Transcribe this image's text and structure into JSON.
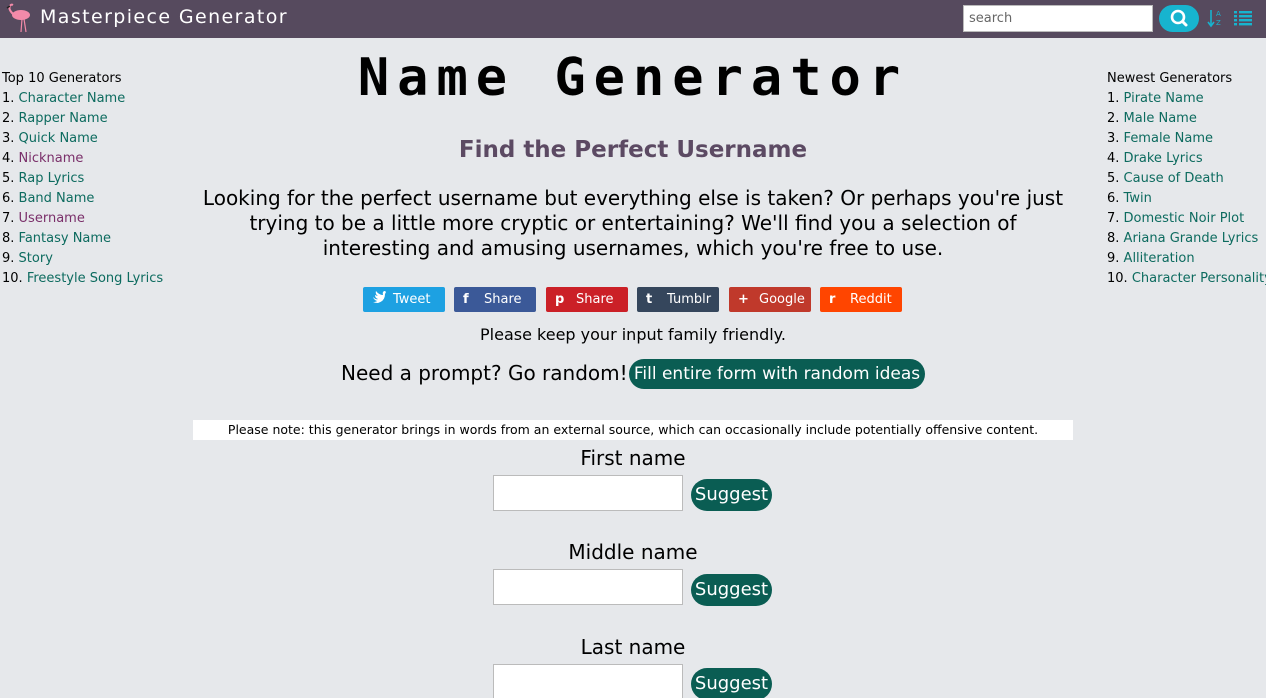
{
  "header": {
    "brand": "Masterpiece Generator",
    "search_placeholder": "search",
    "accent_color": "#17b4cf",
    "bar_color": "#564a5e",
    "icons": [
      "flamingo-logo-icon",
      "search-icon",
      "sort-alpha-icon",
      "list-icon"
    ]
  },
  "left_sidebar": {
    "heading": "Top 10 Generators",
    "items": [
      {
        "num": "1.",
        "label": "Character Name"
      },
      {
        "num": "2.",
        "label": "Rapper Name"
      },
      {
        "num": "3.",
        "label": "Quick Name"
      },
      {
        "num": "4.",
        "label": "Nickname"
      },
      {
        "num": "5.",
        "label": "Rap Lyrics"
      },
      {
        "num": "6.",
        "label": "Band Name"
      },
      {
        "num": "7.",
        "label": "Username"
      },
      {
        "num": "8.",
        "label": "Fantasy Name"
      },
      {
        "num": "9.",
        "label": "Story"
      },
      {
        "num": "10.",
        "label": "Freestyle Song Lyrics"
      }
    ]
  },
  "right_sidebar": {
    "heading": "Newest Generators",
    "items": [
      {
        "num": "1.",
        "label": "Pirate Name"
      },
      {
        "num": "2.",
        "label": "Male Name"
      },
      {
        "num": "3.",
        "label": "Female Name"
      },
      {
        "num": "4.",
        "label": "Drake Lyrics"
      },
      {
        "num": "5.",
        "label": "Cause of Death"
      },
      {
        "num": "6.",
        "label": "Twin"
      },
      {
        "num": "7.",
        "label": "Domestic Noir Plot"
      },
      {
        "num": "8.",
        "label": "Ariana Grande Lyrics"
      },
      {
        "num": "9.",
        "label": "Alliteration"
      },
      {
        "num": "10.",
        "label": "Character Personality"
      }
    ]
  },
  "main": {
    "title": "Name Generator",
    "subtitle": "Find the Perfect Username",
    "intro": "Looking for the perfect username but everything else is taken? Or perhaps you're just trying to be a little more cryptic or entertaining? We'll find you a selection of interesting and amusing usernames, which you're free to use.",
    "share_buttons": [
      {
        "label": "Tweet",
        "icon": "twitter-icon",
        "glyph": "t",
        "color": "#1da1e2"
      },
      {
        "label": "Share",
        "icon": "facebook-icon",
        "glyph": "f",
        "color": "#3b5998"
      },
      {
        "label": "Share",
        "icon": "pinterest-icon",
        "glyph": "p",
        "color": "#cb2027"
      },
      {
        "label": "Tumblr",
        "icon": "tumblr-icon",
        "glyph": "t",
        "color": "#35465c"
      },
      {
        "label": "Google",
        "icon": "google-plus-icon",
        "glyph": "+",
        "color": "#c0392b"
      },
      {
        "label": "Reddit",
        "icon": "reddit-icon",
        "glyph": "r",
        "color": "#ff4500"
      }
    ],
    "family_note": "Please keep your input family friendly.",
    "prompt_label": "Need a prompt? Go random!",
    "random_button": "Fill entire form with random ideas",
    "offensive_note": "Please note: this generator brings in words from an external source, which can occasionally include potentially offensive content.",
    "fields": [
      {
        "label": "First name",
        "value": "",
        "suggest": "Suggest"
      },
      {
        "label": "Middle name",
        "value": "",
        "suggest": "Suggest"
      },
      {
        "label": "Last name",
        "value": "",
        "suggest": "Suggest"
      }
    ],
    "button_color": "#0a5d53"
  }
}
